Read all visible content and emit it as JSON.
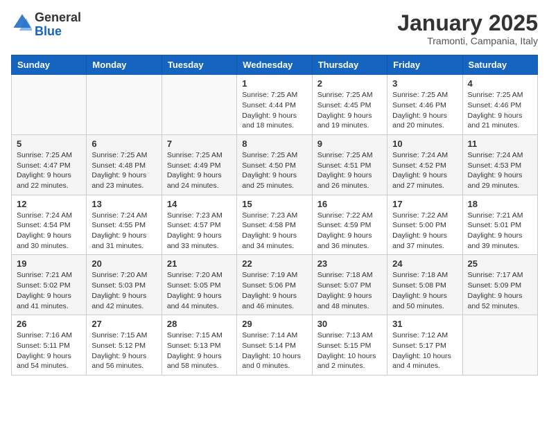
{
  "header": {
    "logo_general": "General",
    "logo_blue": "Blue",
    "month_title": "January 2025",
    "location": "Tramonti, Campania, Italy"
  },
  "days_of_week": [
    "Sunday",
    "Monday",
    "Tuesday",
    "Wednesday",
    "Thursday",
    "Friday",
    "Saturday"
  ],
  "weeks": [
    [
      {
        "day": "",
        "info": ""
      },
      {
        "day": "",
        "info": ""
      },
      {
        "day": "",
        "info": ""
      },
      {
        "day": "1",
        "info": "Sunrise: 7:25 AM\nSunset: 4:44 PM\nDaylight: 9 hours\nand 18 minutes."
      },
      {
        "day": "2",
        "info": "Sunrise: 7:25 AM\nSunset: 4:45 PM\nDaylight: 9 hours\nand 19 minutes."
      },
      {
        "day": "3",
        "info": "Sunrise: 7:25 AM\nSunset: 4:46 PM\nDaylight: 9 hours\nand 20 minutes."
      },
      {
        "day": "4",
        "info": "Sunrise: 7:25 AM\nSunset: 4:46 PM\nDaylight: 9 hours\nand 21 minutes."
      }
    ],
    [
      {
        "day": "5",
        "info": "Sunrise: 7:25 AM\nSunset: 4:47 PM\nDaylight: 9 hours\nand 22 minutes."
      },
      {
        "day": "6",
        "info": "Sunrise: 7:25 AM\nSunset: 4:48 PM\nDaylight: 9 hours\nand 23 minutes."
      },
      {
        "day": "7",
        "info": "Sunrise: 7:25 AM\nSunset: 4:49 PM\nDaylight: 9 hours\nand 24 minutes."
      },
      {
        "day": "8",
        "info": "Sunrise: 7:25 AM\nSunset: 4:50 PM\nDaylight: 9 hours\nand 25 minutes."
      },
      {
        "day": "9",
        "info": "Sunrise: 7:25 AM\nSunset: 4:51 PM\nDaylight: 9 hours\nand 26 minutes."
      },
      {
        "day": "10",
        "info": "Sunrise: 7:24 AM\nSunset: 4:52 PM\nDaylight: 9 hours\nand 27 minutes."
      },
      {
        "day": "11",
        "info": "Sunrise: 7:24 AM\nSunset: 4:53 PM\nDaylight: 9 hours\nand 29 minutes."
      }
    ],
    [
      {
        "day": "12",
        "info": "Sunrise: 7:24 AM\nSunset: 4:54 PM\nDaylight: 9 hours\nand 30 minutes."
      },
      {
        "day": "13",
        "info": "Sunrise: 7:24 AM\nSunset: 4:55 PM\nDaylight: 9 hours\nand 31 minutes."
      },
      {
        "day": "14",
        "info": "Sunrise: 7:23 AM\nSunset: 4:57 PM\nDaylight: 9 hours\nand 33 minutes."
      },
      {
        "day": "15",
        "info": "Sunrise: 7:23 AM\nSunset: 4:58 PM\nDaylight: 9 hours\nand 34 minutes."
      },
      {
        "day": "16",
        "info": "Sunrise: 7:22 AM\nSunset: 4:59 PM\nDaylight: 9 hours\nand 36 minutes."
      },
      {
        "day": "17",
        "info": "Sunrise: 7:22 AM\nSunset: 5:00 PM\nDaylight: 9 hours\nand 37 minutes."
      },
      {
        "day": "18",
        "info": "Sunrise: 7:21 AM\nSunset: 5:01 PM\nDaylight: 9 hours\nand 39 minutes."
      }
    ],
    [
      {
        "day": "19",
        "info": "Sunrise: 7:21 AM\nSunset: 5:02 PM\nDaylight: 9 hours\nand 41 minutes."
      },
      {
        "day": "20",
        "info": "Sunrise: 7:20 AM\nSunset: 5:03 PM\nDaylight: 9 hours\nand 42 minutes."
      },
      {
        "day": "21",
        "info": "Sunrise: 7:20 AM\nSunset: 5:05 PM\nDaylight: 9 hours\nand 44 minutes."
      },
      {
        "day": "22",
        "info": "Sunrise: 7:19 AM\nSunset: 5:06 PM\nDaylight: 9 hours\nand 46 minutes."
      },
      {
        "day": "23",
        "info": "Sunrise: 7:18 AM\nSunset: 5:07 PM\nDaylight: 9 hours\nand 48 minutes."
      },
      {
        "day": "24",
        "info": "Sunrise: 7:18 AM\nSunset: 5:08 PM\nDaylight: 9 hours\nand 50 minutes."
      },
      {
        "day": "25",
        "info": "Sunrise: 7:17 AM\nSunset: 5:09 PM\nDaylight: 9 hours\nand 52 minutes."
      }
    ],
    [
      {
        "day": "26",
        "info": "Sunrise: 7:16 AM\nSunset: 5:11 PM\nDaylight: 9 hours\nand 54 minutes."
      },
      {
        "day": "27",
        "info": "Sunrise: 7:15 AM\nSunset: 5:12 PM\nDaylight: 9 hours\nand 56 minutes."
      },
      {
        "day": "28",
        "info": "Sunrise: 7:15 AM\nSunset: 5:13 PM\nDaylight: 9 hours\nand 58 minutes."
      },
      {
        "day": "29",
        "info": "Sunrise: 7:14 AM\nSunset: 5:14 PM\nDaylight: 10 hours\nand 0 minutes."
      },
      {
        "day": "30",
        "info": "Sunrise: 7:13 AM\nSunset: 5:15 PM\nDaylight: 10 hours\nand 2 minutes."
      },
      {
        "day": "31",
        "info": "Sunrise: 7:12 AM\nSunset: 5:17 PM\nDaylight: 10 hours\nand 4 minutes."
      },
      {
        "day": "",
        "info": ""
      }
    ]
  ]
}
